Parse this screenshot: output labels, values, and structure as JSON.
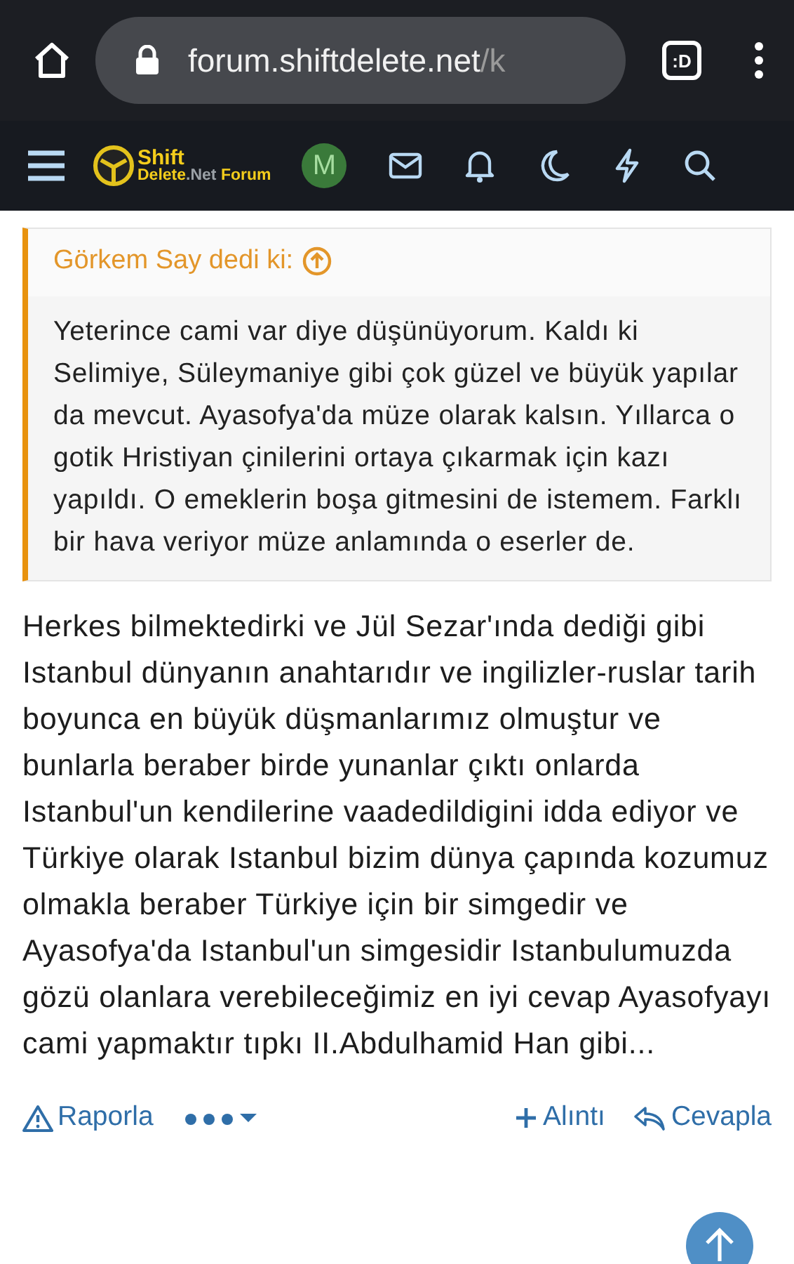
{
  "browser": {
    "url_host": "forum.shiftdelete.net",
    "url_path": "/k",
    "tab_badge": ":D"
  },
  "nav": {
    "logo_top": "Shift",
    "logo_bottom": "Delete",
    "logo_net": ".Net",
    "logo_forum": "Forum",
    "avatar_letter": "M"
  },
  "quote": {
    "author": "Görkem Say dedi ki:",
    "text": "Yeterince cami var diye düşünüyorum. Kaldı ki Selimiye, Süleymaniye gibi çok güzel ve büyük yapılar da mevcut. Ayasofya'da müze olarak kalsın. Yıllarca o gotik Hristiyan çinilerini ortaya çıkarmak için kazı yapıldı. O emeklerin boşa gitmesini de istemem. Farklı bir hava veriyor müze anlamında o eserler de."
  },
  "post": {
    "text": "Herkes bilmektedirki ve Jül Sezar'ında dediği gibi Istanbul dünyanın anahtarıdır ve ingilizler-ruslar tarih boyunca en büyük düşmanlarımız olmuştur ve bunlarla beraber birde yunanlar çıktı onlarda Istanbul'un kendilerine vaadedildigini idda ediyor ve Türkiye olarak Istanbul bizim dünya çapında kozumuz olmakla beraber Türkiye için bir simgedir ve Ayasofya'da Istanbul'un simgesidir Istanbulumuzda gözü olanlara verebileceğimiz en iyi cevap Ayasofyayı cami yapmaktır tıpkı II.Abdulhamid Han gibi..."
  },
  "actions": [
    {
      "kind": "report",
      "label": "Raporla"
    },
    {
      "kind": "more"
    },
    {
      "kind": "quote",
      "label": "Alıntı"
    },
    {
      "kind": "reply",
      "label": "Cevapla"
    }
  ]
}
